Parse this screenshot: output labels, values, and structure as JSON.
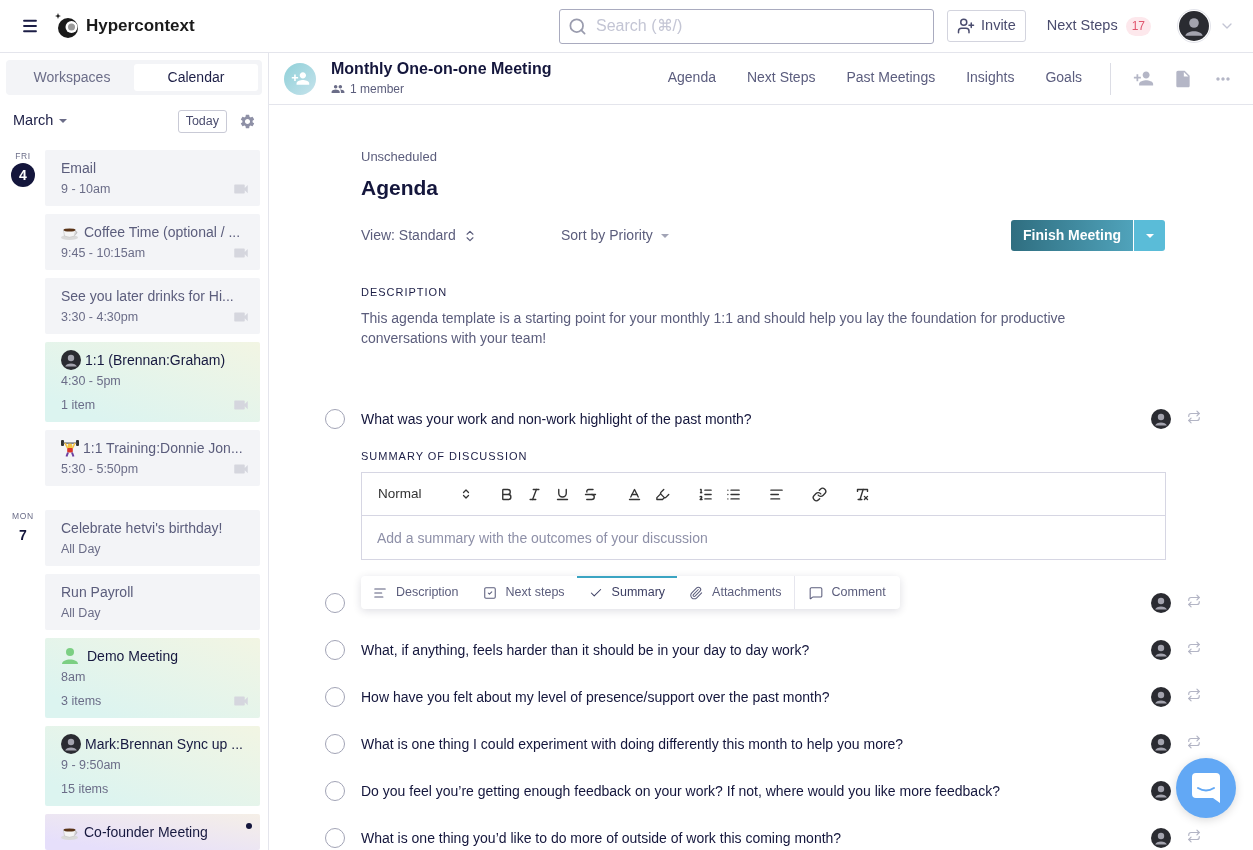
{
  "app": {
    "name": "Hypercontext"
  },
  "search": {
    "placeholder": "Search (⌘/)"
  },
  "topbar": {
    "invite": "Invite",
    "next_steps": {
      "label": "Next Steps",
      "count": "17"
    }
  },
  "sidebar": {
    "tabs": [
      {
        "label": "Workspaces",
        "selected": false
      },
      {
        "label": "Calendar",
        "selected": true
      }
    ],
    "month": "March",
    "today_button": "Today",
    "days": [
      {
        "weekday": "FRI",
        "date": "4",
        "today": true,
        "events": [
          {
            "title": "Email",
            "time": "9 - 10am",
            "kind": "event",
            "video": true,
            "unread": false
          },
          {
            "title": "Coffee Time (optional / ...",
            "time": "9:45 - 10:15am",
            "kind": "event",
            "video": true,
            "unread": false,
            "icon": {
              "kind": "cup"
            }
          },
          {
            "title": "See you later drinks for Hi...",
            "time": "3:30 - 4:30pm",
            "kind": "event",
            "video": true,
            "unread": false
          },
          {
            "title": "1:1 (Brennan:Graham)",
            "time": "4:30 - 5pm",
            "items": "1 item",
            "kind": "meeting",
            "color": "#dcf4f0",
            "video": true,
            "unread": false,
            "icon": {
              "kind": "photo"
            }
          },
          {
            "title": "1:1 Training:Donnie Jon...",
            "time": "5:30 - 5:50pm",
            "kind": "event",
            "video": true,
            "unread": false,
            "icon": {
              "kind": "lifter"
            }
          }
        ]
      },
      {
        "weekday": "MON",
        "date": "7",
        "today": false,
        "events": [
          {
            "title": "Celebrate hetvi's birthday!",
            "time": "All Day",
            "kind": "event",
            "video": false,
            "unread": false
          },
          {
            "title": "Run Payroll",
            "time": "All Day",
            "kind": "event",
            "video": false,
            "unread": false
          },
          {
            "title": "Demo Meeting",
            "time": "8am",
            "items": "3 items",
            "kind": "meeting",
            "color": "#dcf4f0",
            "video": true,
            "unread": false,
            "icon": {
              "kind": "person"
            }
          },
          {
            "title": "Mark:Brennan Sync up ...",
            "time": "9 - 9:50am",
            "items": "15 items",
            "kind": "meeting",
            "color": "#dcf4f0",
            "video": false,
            "unread": false,
            "icon": {
              "kind": "photo"
            }
          },
          {
            "title": "Co-founder Meeting",
            "kind": "meeting",
            "color": "#e6dffb",
            "video": false,
            "unread": true,
            "icon": {
              "kind": "cup"
            }
          }
        ]
      }
    ]
  },
  "meeting": {
    "title": "Monthly One-on-one Meeting",
    "members": "1 member",
    "tabs": [
      {
        "label": "Agenda",
        "selected": false
      },
      {
        "label": "Next Steps",
        "selected": false
      },
      {
        "label": "Past Meetings",
        "selected": false
      },
      {
        "label": "Insights",
        "selected": false
      },
      {
        "label": "Goals",
        "selected": false
      }
    ]
  },
  "agenda": {
    "status": "Unscheduled",
    "title": "Agenda",
    "view": "View: Standard",
    "sort": "Sort by Priority",
    "finish_button": "Finish Meeting",
    "description_label": "DESCRIPTION",
    "description": "This agenda template is a starting point for your monthly 1:1 and should help you lay the foundation for productive conversations with your team!",
    "items": [
      {
        "text": "What was your work and non-work highlight of the past month?",
        "checked": false,
        "summary": {
          "label": "SUMMARY OF DISCUSSION",
          "format": "Normal",
          "placeholder": "Add a summary with the outcomes of your discussion"
        }
      },
      {
        "checked": false,
        "menu": {
          "tabs": [
            {
              "label": "Description",
              "kind": "tab",
              "selected": false
            },
            {
              "label": "Next steps",
              "kind": "tab",
              "selected": false
            },
            {
              "label": "Summary",
              "kind": "tab",
              "selected": true
            },
            {
              "label": "Attachments",
              "kind": "tab",
              "selected": false
            },
            {
              "label": "Comment",
              "kind": "action",
              "selected": false
            }
          ]
        }
      },
      {
        "text": "What, if anything, feels harder than it should be in your day to day work?",
        "checked": false
      },
      {
        "text": "How have you felt about my level of presence/support over the past month?",
        "checked": false
      },
      {
        "text": "What is one thing I could experiment with doing differently this month to help you more?",
        "checked": false
      },
      {
        "text": "Do you feel you’re getting enough feedback on your work? If not, where would you like more feedback?",
        "checked": false
      },
      {
        "text": "What is one thing you’d like to do more of outside of work this coming month?",
        "checked": false
      }
    ]
  }
}
